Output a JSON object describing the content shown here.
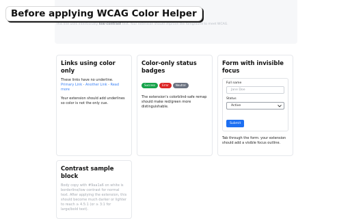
{
  "banner": {
    "title": "Before applying WCAG Color Helper",
    "low_contrast_prefix": "This line uses intentionally ",
    "low_contrast_bold": "low-contrast",
    "low_contrast_suffix": " text. Your extension should improve the foreground to meet WCAG."
  },
  "links_card": {
    "title": "Links using color only",
    "intro": "These links have no underline. ",
    "link1": "Primary Link",
    "sep1": " · ",
    "link2": "Another Link",
    "sep2": " · ",
    "link3": "Read more",
    "note": "Your extension should add underlines so color is not the only cue."
  },
  "status_card": {
    "title": "Color-only status badges",
    "badges": [
      {
        "label": "Success",
        "color": "#16a34a"
      },
      {
        "label": "Error",
        "color": "#dc2626"
      },
      {
        "label": "Neutral",
        "color": "#6b7280"
      }
    ],
    "note": "The extension's colorblind-safe remap should make red/green more distinguishable."
  },
  "form_card": {
    "title": "Form with invisible focus",
    "full_name_label": "Full name",
    "full_name_placeholder": "Jane Doe",
    "status_label": "Status",
    "status_value": "Active",
    "submit_label": "Submit",
    "note": "Tab through the form: your extension should add a visible focus outline."
  },
  "contrast_card": {
    "title": "Contrast sample block",
    "body": "Body copy with #9aa1a6 on white is borderline/low contrast for normal text. After applying the extension, this should become much darker or lighter to reach ≥ 4.5:1 (or ≥ 3:1 for large/bold text)."
  },
  "colors": {
    "link": "#3b82f6",
    "primary_button": "#1d6ff2",
    "low_contrast_text": "#9aa1a6"
  }
}
